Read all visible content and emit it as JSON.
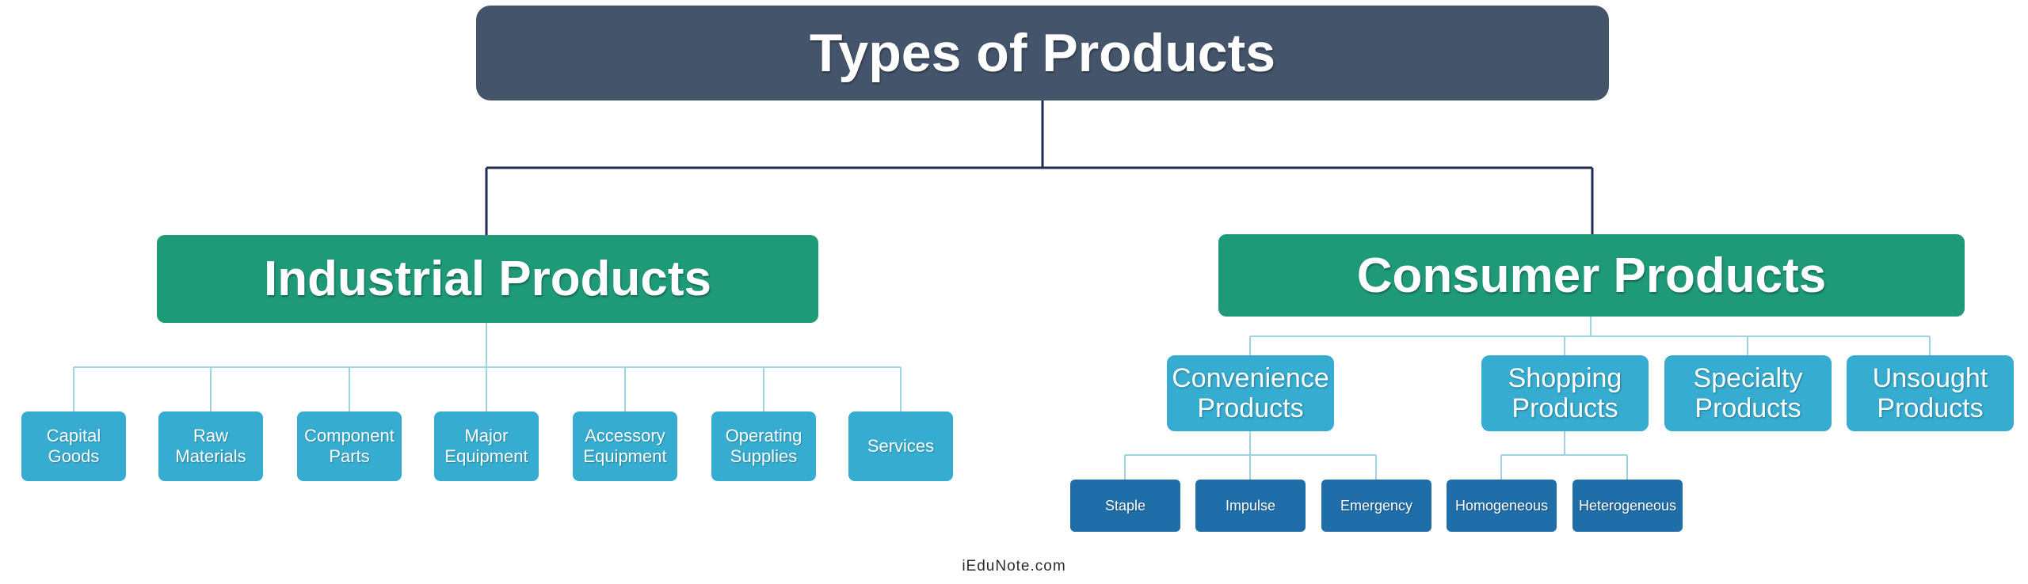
{
  "diagram": {
    "title": "Types of Products",
    "categories": [
      {
        "label": "Industrial Products",
        "children": [
          {
            "label": "Capital\nGoods"
          },
          {
            "label": "Raw\nMaterials"
          },
          {
            "label": "Component\nParts"
          },
          {
            "label": "Major\nEquipment"
          },
          {
            "label": "Accessory\nEquipment"
          },
          {
            "label": "Operating\nSupplies"
          },
          {
            "label": "Services"
          }
        ]
      },
      {
        "label": "Consumer Products",
        "children": [
          {
            "label": "Convenience\nProducts",
            "children": [
              {
                "label": "Staple"
              },
              {
                "label": "Impulse"
              },
              {
                "label": "Emergency"
              }
            ]
          },
          {
            "label": "Shopping\nProducts",
            "children": [
              {
                "label": "Homogeneous"
              },
              {
                "label": "Heterogeneous"
              }
            ]
          },
          {
            "label": "Specialty\nProducts"
          },
          {
            "label": "Unsought\nProducts"
          }
        ]
      }
    ]
  },
  "footer": {
    "source": "iEduNote.com"
  },
  "colors": {
    "root": "#44546a",
    "category": "#1e9a78",
    "child": "#36acd0",
    "grandchild": "#1f6ea9",
    "main_connector": "#1f2d5a",
    "sub_connector": "#9dd3e3"
  }
}
